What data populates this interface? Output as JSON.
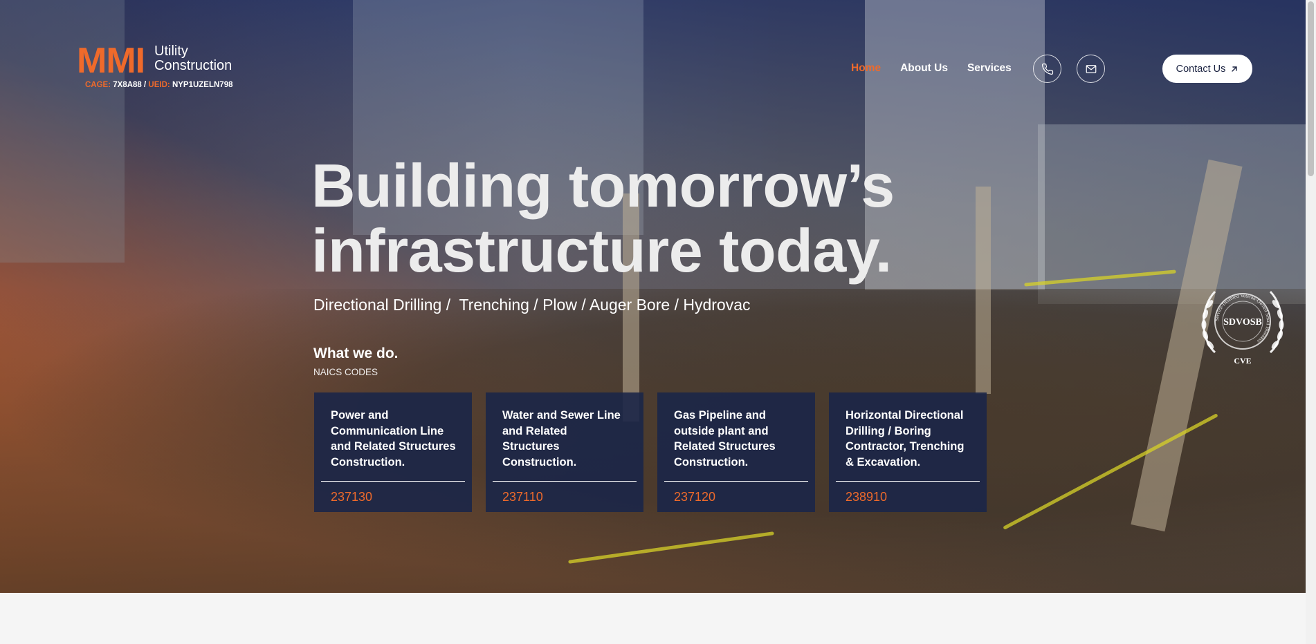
{
  "logo": {
    "mark": "MMI",
    "sub_line1": "Utility",
    "sub_line2": "Construction",
    "cage_key": "CAGE:",
    "cage_value": "7X8A88 /",
    "ueid_key": "UEID:",
    "ueid_value": "NYP1UZELN798"
  },
  "nav": {
    "items": [
      {
        "label": "Home",
        "active": true
      },
      {
        "label": "About Us"
      },
      {
        "label": "Services"
      }
    ]
  },
  "header": {
    "phone_icon": "phone-icon",
    "mail_icon": "mail-icon",
    "contact_label": "Contact Us"
  },
  "hero": {
    "headline_line1": "Building tomorrow’s",
    "headline_line2": "infrastructure today.",
    "tagline": "Directional Drilling /  Trenching / Plow / Auger Bore / Hydrovac",
    "section_title": "What we do.",
    "section_subtitle": "NAICS CODES",
    "badge_text": "SDVOSB",
    "badge_ring": "Service-Disabled Veteran-Owned Small Business",
    "badge_mark": "CVE"
  },
  "cards": [
    {
      "title": "Power and\nCommunication Line\nand Related Structures\nConstruction.",
      "code": "237130"
    },
    {
      "title": "Water and Sewer Line\nand Related\nStructures\nConstruction.",
      "code": "237110"
    },
    {
      "title": "Gas Pipeline and\noutside plant and\nRelated  Structures\nConstruction.",
      "code": "237120"
    },
    {
      "title": "Horizontal Directional\nDrilling / Boring\nContractor, Trenching\n& Excavation.",
      "code": "238910"
    }
  ],
  "colors": {
    "accent": "#ef6a2b",
    "card_bg": "#1b2648",
    "text_light": "#ececec"
  }
}
